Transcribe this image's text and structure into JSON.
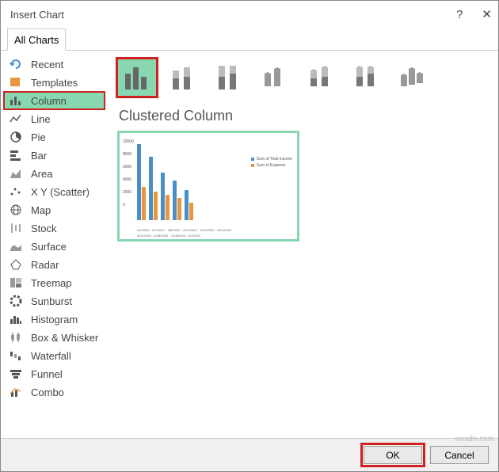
{
  "window": {
    "title": "Insert Chart"
  },
  "tabs": {
    "all": "All Charts"
  },
  "sidebar": {
    "items": [
      "Recent",
      "Templates",
      "Column",
      "Line",
      "Pie",
      "Bar",
      "Area",
      "X Y (Scatter)",
      "Map",
      "Stock",
      "Surface",
      "Radar",
      "Treemap",
      "Sunburst",
      "Histogram",
      "Box & Whisker",
      "Waterfall",
      "Funnel",
      "Combo"
    ]
  },
  "subtypes": {
    "names": [
      "clustered-column",
      "stacked-column",
      "100-stacked-column",
      "3d-clustered-column",
      "3d-stacked-column",
      "3d-100-stacked-column",
      "3d-column"
    ]
  },
  "chart": {
    "title": "Clustered Column"
  },
  "footer": {
    "ok": "OK",
    "cancel": "Cancel"
  },
  "watermark": "wsxdn.com",
  "chart_data": {
    "type": "bar",
    "ylim": [
      0,
      10000
    ],
    "yticks": [
      10000,
      8000,
      6000,
      4000,
      2000,
      0
    ],
    "categories": [
      "4/1/2020 - 4/7/2020",
      "4/8/2020 - 4/14/2020",
      "4/14/2020 - 4/21/2020",
      "4/21/2020 - 4/28/2020",
      "4/28/2020 - 5/1/2020"
    ],
    "series": [
      {
        "name": "Sum of Total income",
        "color": "#4a8ec9",
        "values": [
          9600,
          8000,
          6000,
          5000,
          3800
        ]
      },
      {
        "name": "Sum of Expense",
        "color": "#e8963e",
        "values": [
          4200,
          3600,
          3200,
          2800,
          2200
        ]
      }
    ]
  }
}
